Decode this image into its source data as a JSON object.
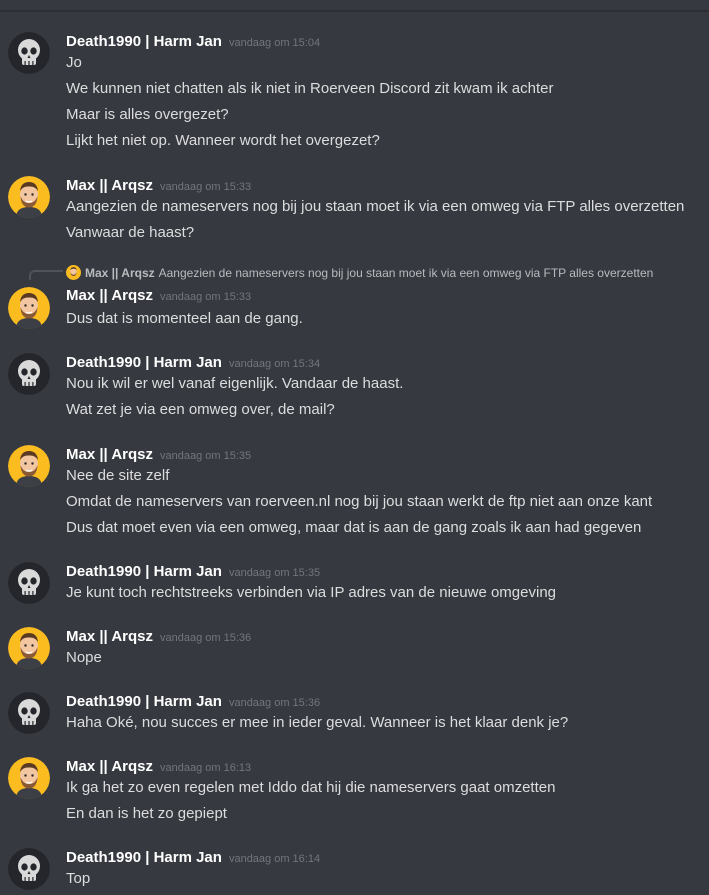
{
  "colors": {
    "background": "#36393f",
    "author": "#ffffff",
    "text": "#dcddde",
    "timestamp": "#72767d",
    "harm_avatar_bg": "#24262b",
    "max_avatar_bg": "#fbbc20"
  },
  "messages": [
    {
      "author": "Death1990 | Harm Jan",
      "avatar": "skull-avatar",
      "timestamp": "vandaag om 15:04",
      "lines": [
        "Jo",
        "We kunnen niet chatten als ik niet in Roerveen Discord zit kwam ik achter",
        "Maar is alles overgezet?",
        "Lijkt het niet op. Wanneer wordt het overgezet?"
      ]
    },
    {
      "author": "Max || Arqsz",
      "avatar": "bearded-man-avatar",
      "timestamp": "vandaag om 15:33",
      "lines": [
        "Aangezien de nameservers nog bij jou staan moet ik via een omweg via FTP alles overzetten",
        "Vanwaar de haast?"
      ]
    },
    {
      "reply_to": {
        "author": "Max || Arqsz",
        "text": "Aangezien de nameservers nog bij jou staan moet ik via een omweg via FTP alles overzetten"
      },
      "author": "Max || Arqsz",
      "avatar": "bearded-man-avatar",
      "timestamp": "vandaag om 15:33",
      "lines": [
        "Dus dat is momenteel aan de gang."
      ]
    },
    {
      "author": "Death1990 | Harm Jan",
      "avatar": "skull-avatar",
      "timestamp": "vandaag om 15:34",
      "lines": [
        "Nou ik wil er wel vanaf eigenlijk. Vandaar de haast.",
        "Wat zet je via een omweg over, de mail?"
      ]
    },
    {
      "author": "Max || Arqsz",
      "avatar": "bearded-man-avatar",
      "timestamp": "vandaag om 15:35",
      "lines": [
        "Nee de site zelf",
        "Omdat de nameservers van roerveen.nl nog bij jou staan werkt de ftp niet aan onze kant",
        "Dus dat moet even via een omweg, maar dat is aan de gang zoals ik aan had gegeven"
      ]
    },
    {
      "author": "Death1990 | Harm Jan",
      "avatar": "skull-avatar",
      "timestamp": "vandaag om 15:35",
      "lines": [
        "Je kunt toch rechtstreeks verbinden via IP adres van de nieuwe omgeving"
      ]
    },
    {
      "author": "Max || Arqsz",
      "avatar": "bearded-man-avatar",
      "timestamp": "vandaag om 15:36",
      "lines": [
        "Nope"
      ]
    },
    {
      "author": "Death1990 | Harm Jan",
      "avatar": "skull-avatar",
      "timestamp": "vandaag om 15:36",
      "lines": [
        "Haha Oké, nou succes er mee in ieder geval. Wanneer is het klaar denk je?"
      ]
    },
    {
      "author": "Max || Arqsz",
      "avatar": "bearded-man-avatar",
      "timestamp": "vandaag om 16:13",
      "lines": [
        "Ik ga het zo even regelen met Iddo dat hij die nameservers gaat omzetten",
        "En dan is het zo gepiept"
      ]
    },
    {
      "author": "Death1990 | Harm Jan",
      "avatar": "skull-avatar",
      "timestamp": "vandaag om 16:14",
      "lines": [
        "Top"
      ]
    }
  ]
}
